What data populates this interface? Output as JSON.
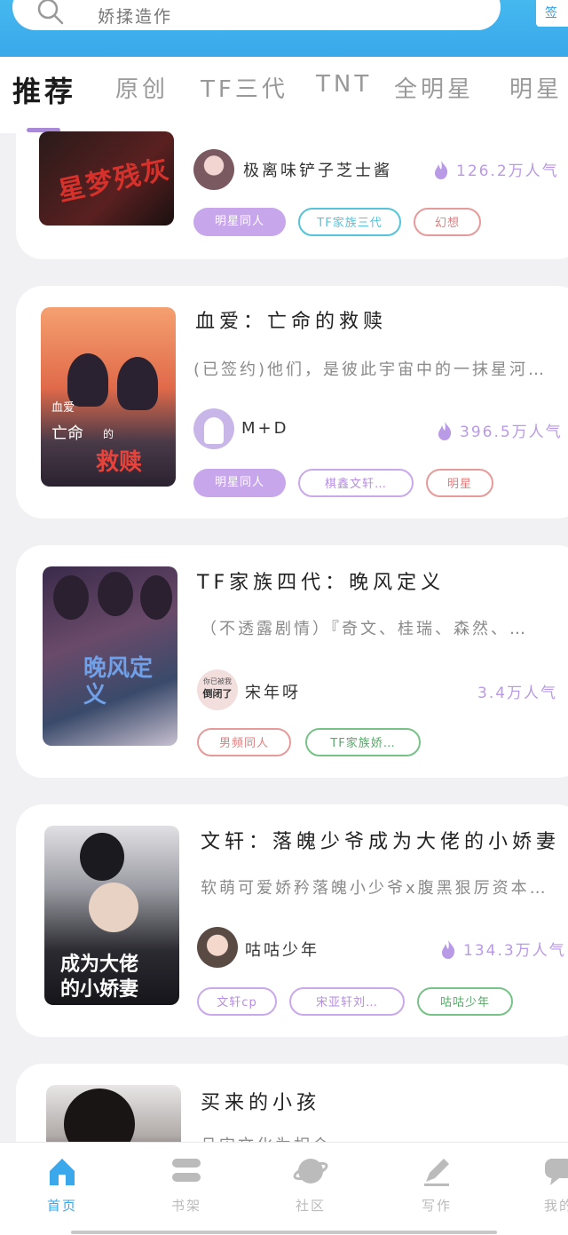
{
  "search": {
    "placeholder": "娇揉造作",
    "icon": "search-icon"
  },
  "sign_label": "签",
  "tabs": [
    "推荐",
    "原创",
    "TF三代",
    "TNT",
    "全明星",
    "明星"
  ],
  "active_tab": "推荐",
  "books": [
    {
      "title": "",
      "cover_text": "星梦残灰",
      "author": "极离味铲子芝士酱",
      "popularity": "126.2万人气",
      "tags": [
        "明星同人",
        "TF家族三代",
        "幻想"
      ]
    },
    {
      "title": "血爱：亡命的救赎",
      "desc": "(已签约)他们，是彼此宇宙中的一抹星河…",
      "cover_text_a": "血爱",
      "cover_text_b": "亡命",
      "cover_text_c": "的",
      "cover_text_d": "救赎",
      "author": "M+D",
      "popularity": "396.5万人气",
      "tags": [
        "明星同人",
        "棋鑫文轩…",
        "明星"
      ]
    },
    {
      "title": "TF家族四代：晚风定义",
      "desc": "（不透露剧情）『奇文、桂瑞、森然、…",
      "cover_text": "晚风定义",
      "avatar_text_a": "你已被我",
      "avatar_text_b": "倒闭了",
      "author": "宋年呀",
      "popularity": "3.4万人气",
      "tags": [
        "男频同人",
        "TF家族娇…"
      ]
    },
    {
      "title": "文轩：落魄少爷成为大佬的小娇妻",
      "desc": "软萌可爱娇矜落魄小少爷x腹黑狠厉资本…",
      "cover_text_a": "成为大佬",
      "cover_text_b": "的小娇妻",
      "author": "咕咕少年",
      "popularity": "134.3万人气",
      "tags": [
        "文轩cp",
        "宋亚轩刘…",
        "咕咕少年"
      ]
    },
    {
      "title": "买来的小孩",
      "desc": "且宋文化为相会"
    }
  ],
  "nav": [
    {
      "label": "首页",
      "icon": "home-icon"
    },
    {
      "label": "书架",
      "icon": "bookshelf-icon"
    },
    {
      "label": "社区",
      "icon": "planet-icon"
    },
    {
      "label": "写作",
      "icon": "pen-icon"
    },
    {
      "label": "我的",
      "icon": "chat-icon"
    }
  ],
  "colors": {
    "accent": "#3aa8ea",
    "tab_indicator": "#a98ad8",
    "popularity": "#b99ae6"
  }
}
